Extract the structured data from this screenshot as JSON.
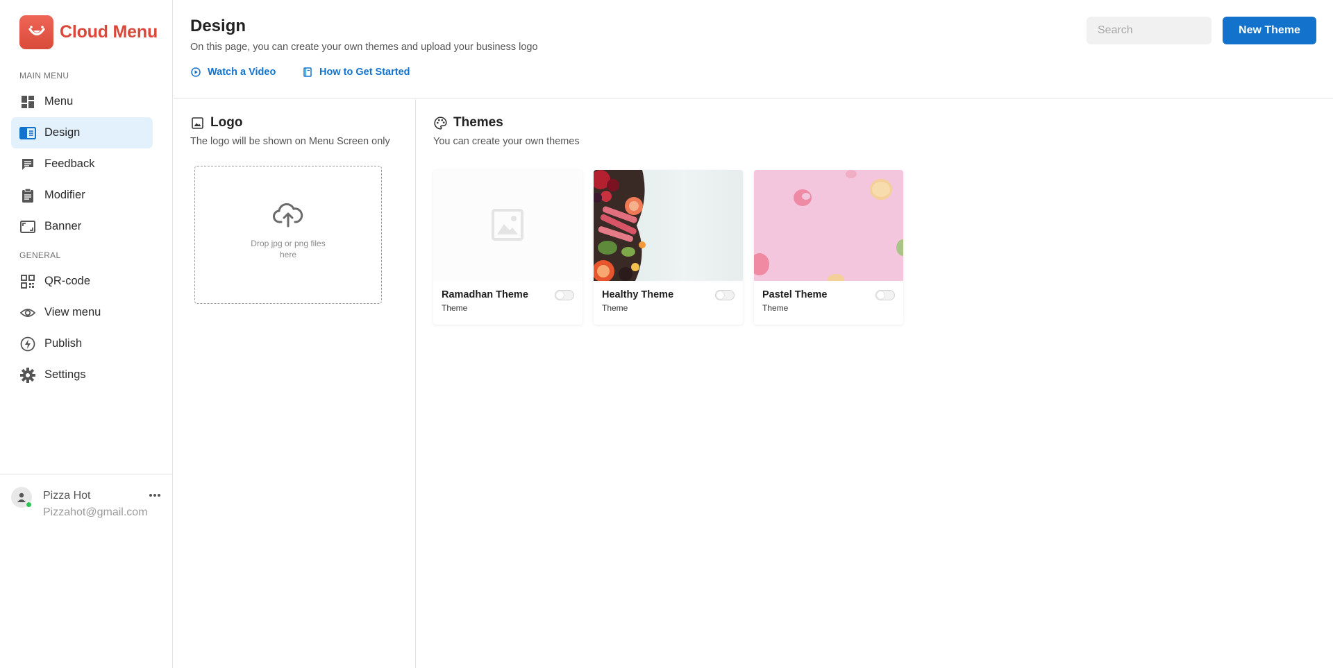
{
  "app": {
    "name": "Cloud Menu",
    "brand_color": "#d9483b",
    "accent_color": "#1272cc"
  },
  "sidebar": {
    "sections": {
      "main": "MAIN MENU",
      "general": "GENERAL"
    },
    "items": [
      {
        "label": "Menu",
        "icon": "dashboard-icon",
        "active": false
      },
      {
        "label": "Design",
        "icon": "design-book-icon",
        "active": true
      },
      {
        "label": "Feedback",
        "icon": "chat-icon",
        "active": false
      },
      {
        "label": "Modifier",
        "icon": "clipboard-icon",
        "active": false
      },
      {
        "label": "Banner",
        "icon": "banner-frame-icon",
        "active": false
      },
      {
        "label": "QR-code",
        "icon": "qr-code-icon",
        "active": false
      },
      {
        "label": "View menu",
        "icon": "eye-icon",
        "active": false
      },
      {
        "label": "Publish",
        "icon": "bolt-icon",
        "active": false
      },
      {
        "label": "Settings",
        "icon": "gear-icon",
        "active": false
      }
    ],
    "user": {
      "name": "Pizza Hot",
      "email": "Pizzahot@gmail.com",
      "status": "online"
    }
  },
  "header": {
    "title": "Design",
    "subtitle": "On this page, you can create your own themes and upload your business logo",
    "links": [
      {
        "label": "Watch a Video",
        "icon": "play-circle-icon"
      },
      {
        "label": "How to Get Started",
        "icon": "book-icon"
      }
    ],
    "search": {
      "placeholder": "Search",
      "value": ""
    },
    "new_theme_label": "New Theme"
  },
  "logo_panel": {
    "title": "Logo",
    "subtitle": "The logo will be shown on Menu Screen only",
    "dropzone_text": "Drop jpg or png files here"
  },
  "themes_panel": {
    "title": "Themes",
    "subtitle": "You can create your own themes",
    "themes": [
      {
        "name": "Ramadhan Theme",
        "type": "Theme",
        "enabled": false,
        "image": "placeholder-image-icon"
      },
      {
        "name": "Healthy Theme",
        "type": "Theme",
        "enabled": false,
        "image": "fruits-photo"
      },
      {
        "name": "Pastel Theme",
        "type": "Theme",
        "enabled": false,
        "image": "macarons-photo"
      }
    ]
  }
}
